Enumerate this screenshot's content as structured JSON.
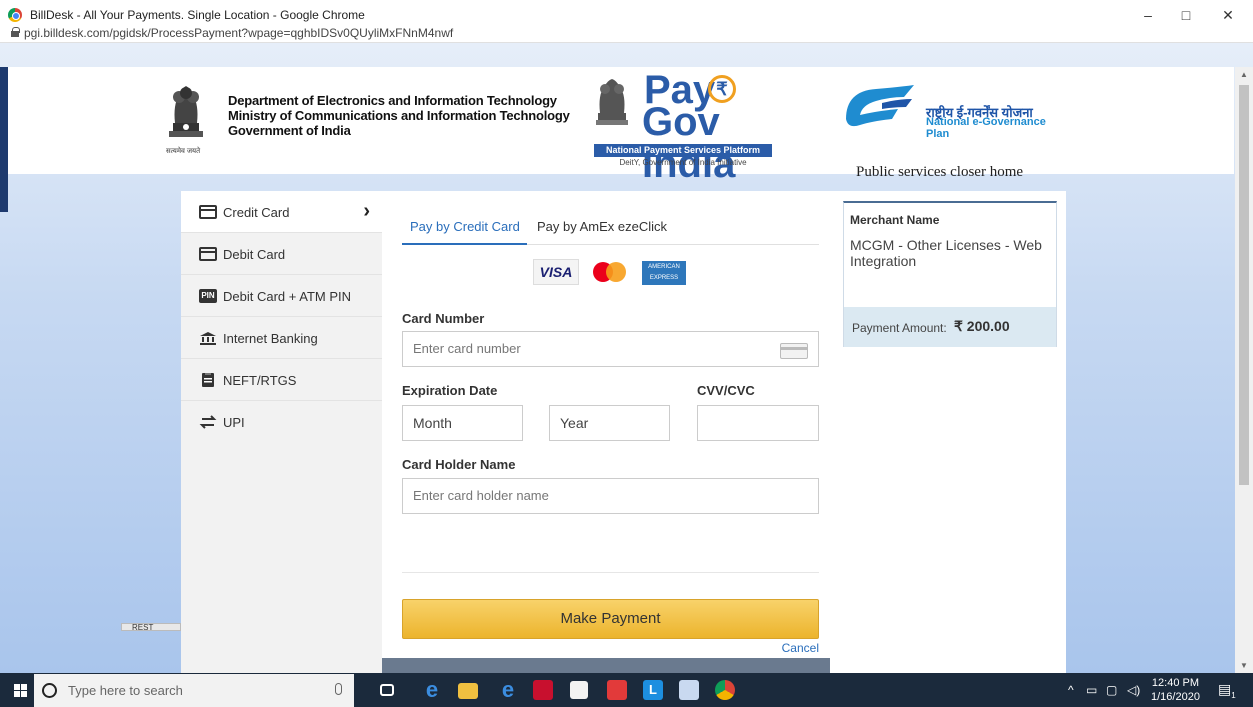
{
  "window": {
    "title": "BillDesk - All Your Payments. Single Location - Google Chrome",
    "url": "pgi.billdesk.com/pgidsk/ProcessPayment?wpage=qghbIDSv0QUyliMxFNnM4nwf",
    "controls": {
      "minimize": "–",
      "maximize": "□",
      "close": "✕"
    }
  },
  "header": {
    "dept_line1": "Department of Electronics and Information Technology",
    "dept_line2": "Ministry of Communications and Information Technology",
    "dept_line3": "Government of India",
    "motto": "सत्यमेव जयते",
    "paygov_pay": "Pay",
    "paygov_gov": "Gov India",
    "paygov_rupee": "₹",
    "paygov_platform": "National Payment Services Platform",
    "paygov_initiative": "DeitY, Government of India Initiative",
    "egov_hindi": "राष्ट्रीय ई-गवर्नेंस योजना",
    "egov_english": "National e-Governance Plan",
    "egov_tagline": "Public services closer home"
  },
  "sidebar": {
    "items": [
      {
        "label": "Credit Card",
        "icon": "credit-card-icon",
        "active": true
      },
      {
        "label": "Debit Card",
        "icon": "debit-card-icon",
        "active": false
      },
      {
        "label": "Debit Card + ATM PIN",
        "icon": "pin-icon",
        "active": false
      },
      {
        "label": "Internet Banking",
        "icon": "bank-icon",
        "active": false
      },
      {
        "label": "NEFT/RTGS",
        "icon": "clipboard-icon",
        "active": false
      },
      {
        "label": "UPI",
        "icon": "transfer-icon",
        "active": false
      }
    ],
    "pin_badge": "PIN",
    "chevron": "›"
  },
  "form": {
    "tabs": [
      {
        "label": "Pay by Credit Card",
        "active": true
      },
      {
        "label": "Pay by AmEx ezeClick",
        "active": false
      }
    ],
    "card_brands": {
      "visa": "VISA",
      "amex": "AMERICAN EXPRESS"
    },
    "card_number_label": "Card Number",
    "card_number_placeholder": "Enter card number",
    "expiration_label": "Expiration Date",
    "month_value": "Month",
    "year_value": "Year",
    "cvv_label": "CVV/CVC",
    "cvv_value": "",
    "holder_label": "Card Holder Name",
    "holder_placeholder": "Enter card holder name",
    "submit_label": "Make Payment",
    "cancel_label": "Cancel"
  },
  "merchant": {
    "label": "Merchant Name",
    "name": "MCGM - Other Licenses - Web Integration",
    "amount_label": "Payment Amount:",
    "amount_value": "₹ 200.00"
  },
  "background_tab": {
    "label": "REST"
  },
  "taskbar": {
    "search_placeholder": "Type here to search",
    "pinned_icons": [
      "task-view-icon",
      "edge-icon",
      "file-explorer-icon",
      "ie-icon",
      "mcafee-icon",
      "store-icon",
      "office-icon",
      "lync-icon",
      "publisher-icon",
      "chrome-icon"
    ],
    "time": "12:40 PM",
    "date": "1/16/2020",
    "notification_count": "1",
    "tray_caret": "^"
  },
  "colors": {
    "accent": "#2a6ebb",
    "button": "#f3c24a",
    "taskbar": "#1b2a3c",
    "header_edge": "#1e3a6e"
  }
}
